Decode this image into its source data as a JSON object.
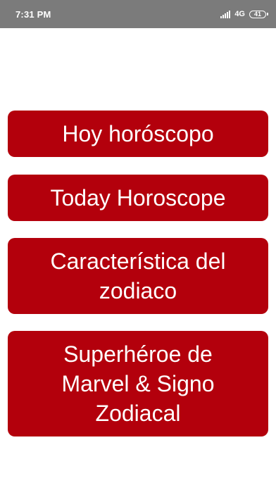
{
  "status_bar": {
    "time": "7:31 PM",
    "network": "4G",
    "battery": "41"
  },
  "menu": {
    "items": [
      {
        "label": "Hoy horóscopo"
      },
      {
        "label": "Today Horoscope"
      },
      {
        "label": "Característica del\nzodiaco"
      },
      {
        "label": "Superhéroe de\nMarvel &  Signo\nZodiacal"
      }
    ]
  },
  "colors": {
    "button_bg": "#b3000c",
    "button_text": "#ffffff",
    "status_bar_bg": "#7b7b7b",
    "page_bg": "#ffffff"
  }
}
